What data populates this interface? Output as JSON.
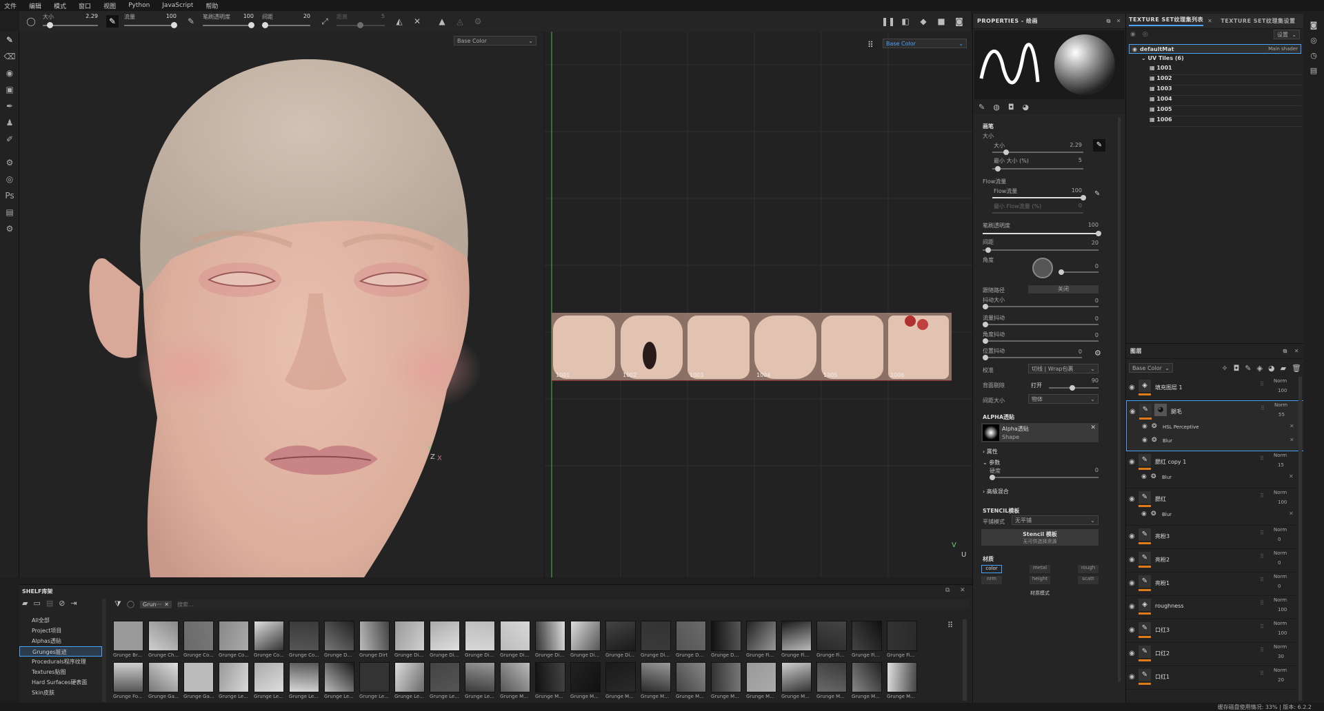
{
  "menu": [
    "文件",
    "编辑",
    "模式",
    "窗口",
    "视图",
    "Python",
    "JavaScript",
    "帮助"
  ],
  "toolbar": {
    "size_label": "大小",
    "size_value": "2.29",
    "flow_label": "流量",
    "flow_value": "100",
    "opacity_label": "笔刷透明度",
    "opacity_value": "100",
    "spacing_label": "间距",
    "spacing_value": "20",
    "jitter_label": "距离",
    "jitter_value": "5"
  },
  "viewport3d": {
    "channel": "Base Color",
    "axis": "Z",
    "axis2": "X",
    "axis3": "Y"
  },
  "viewport2d": {
    "channel": "Base Color",
    "udims": [
      "1001",
      "1002",
      "1003",
      "1004",
      "1005",
      "1006"
    ],
    "axis": "V",
    "axis2": "U"
  },
  "properties": {
    "title": "PROPERTIES - 绘画",
    "brush_section": "画笔",
    "size_heading": "大小",
    "size_label": "大小",
    "size_value": "2.29",
    "min_size_label": "最小 大小 (%)",
    "min_size_value": "5",
    "flow_heading": "Flow流量",
    "flow_label": "Flow流量",
    "flow_value": "100",
    "min_flow_label": "最小 Flow流量 (%)",
    "min_flow_value": "0",
    "opacity_label": "笔刷透明度",
    "opacity_value": "100",
    "spacing_label": "间距",
    "spacing_value": "20",
    "angle_label": "角度",
    "angle_value": "0",
    "follow_path_label": "跟随路径",
    "follow_path_value": "关闭",
    "jitter_size_label": "抖动大小",
    "jitter_size_value": "0",
    "jitter_flow_label": "流量抖动",
    "jitter_flow_value": "0",
    "jitter_angle_label": "角度抖动",
    "jitter_angle_value": "0",
    "jitter_pos_label": "位置抖动",
    "jitter_pos_value": "0",
    "align_label": "校准",
    "align_value": "切线 | Wrap包裹",
    "backface_label": "背面剔除",
    "backface_value": "打开",
    "backface_num": "90",
    "spacing_size_label": "间距大小",
    "spacing_size_value": "物体",
    "alpha_section": "ALPHA透贴",
    "alpha_name": "Alpha透贴",
    "alpha_type": "Shape",
    "attr_label": "属性",
    "param_label": "参数",
    "hardness_label": "硬度",
    "hardness_value": "0",
    "advanced_label": "高级混合",
    "stencil_section": "STENCIL模板",
    "tile_label": "平铺模式",
    "tile_value": "无平铺",
    "stencil_btn": "Stencil 模板",
    "stencil_sub": "无可供选择资源",
    "material_section": "材质",
    "mat_channels": [
      "color",
      "metal",
      "rough",
      "nrm",
      "height",
      "scatt"
    ],
    "mat_mode": "材质模式"
  },
  "texset": {
    "tab1": "TEXTURE SET纹理集列表",
    "tab2": "TEXTURE SET纹理集设置",
    "settings": "设置",
    "mat_name": "defaultMat",
    "mat_shader": "Main shader",
    "uv_label": "UV Tiles (6)",
    "tiles": [
      "1001",
      "1002",
      "1003",
      "1004",
      "1005",
      "1006"
    ]
  },
  "layers": {
    "title": "图层",
    "channel": "Base Color",
    "items": [
      {
        "name": "填充图层 1",
        "blend": "Norm",
        "opacity": "100",
        "type": "fill",
        "effects": []
      },
      {
        "name": "腿毛",
        "blend": "Norm",
        "opacity": "55",
        "type": "paint",
        "selected": true,
        "effects": [
          "HSL Perceptive",
          "Blur"
        ]
      },
      {
        "name": "腮红 copy 1",
        "blend": "Norm",
        "opacity": "15",
        "type": "paint",
        "effects": [
          "Blur"
        ]
      },
      {
        "name": "腮红",
        "blend": "Norm",
        "opacity": "100",
        "type": "paint",
        "effects": [
          "Blur"
        ]
      },
      {
        "name": "亮粉3",
        "blend": "Norm",
        "opacity": "0",
        "type": "paint",
        "effects": []
      },
      {
        "name": "亮粉2",
        "blend": "Norm",
        "opacity": "0",
        "type": "paint",
        "effects": []
      },
      {
        "name": "亮粉1",
        "blend": "Norm",
        "opacity": "0",
        "type": "paint",
        "effects": []
      },
      {
        "name": "roughness",
        "blend": "Norm",
        "opacity": "100",
        "type": "fill",
        "effects": []
      },
      {
        "name": "口红3",
        "blend": "Norm",
        "opacity": "100",
        "type": "paint",
        "effects": []
      },
      {
        "name": "口红2",
        "blend": "Norm",
        "opacity": "30",
        "type": "paint",
        "effects": []
      },
      {
        "name": "口红1",
        "blend": "Norm",
        "opacity": "20",
        "type": "paint",
        "effects": []
      }
    ]
  },
  "shelf": {
    "title": "SHELF库架",
    "filter_tag": "Grun···",
    "search_placeholder": "搜索...",
    "categories": [
      "All全部",
      "Project项目",
      "Alphas透贴",
      "Grunges脏迹",
      "Procedurals程序纹理",
      "Textures贴图",
      "Hard Surfaces硬表面",
      "Skin皮肤"
    ],
    "selected_category": "Grunges脏迹",
    "row1": [
      "Grunge Br...",
      "Grunge Ch...",
      "Grunge Co...",
      "Grunge Co...",
      "Grunge Co...",
      "Grunge Co...",
      "Grunge D...",
      "Grunge Dirt",
      "Grunge Di...",
      "Grunge Di...",
      "Grunge Di...",
      "Grunge Di...",
      "Grunge Di...",
      "Grunge Di...",
      "Grunge Di...",
      "Grunge Di...",
      "Grunge D...",
      "Grunge D...",
      "Grunge Fi...",
      "Grunge Fi...",
      "Grunge Fi...",
      "Grunge Fi...",
      "Grunge Fi..."
    ],
    "row2": [
      "Grunge Fo...",
      "Grunge Ga...",
      "Grunge Ga...",
      "Grunge Le...",
      "Grunge Le...",
      "Grunge Le...",
      "Grunge Le...",
      "Grunge Le...",
      "Grunge Le...",
      "Grunge Le...",
      "Grunge Le...",
      "Grunge M...",
      "Grunge M...",
      "Grunge M...",
      "Grunge M...",
      "Grunge M...",
      "Grunge M...",
      "Grunge M...",
      "Grunge M...",
      "Grunge M...",
      "Grunge M...",
      "Grunge M...",
      "Grunge M..."
    ]
  },
  "status": {
    "text": "缓存磁盘使用情况: 33% | 版本: 6.2.2"
  }
}
